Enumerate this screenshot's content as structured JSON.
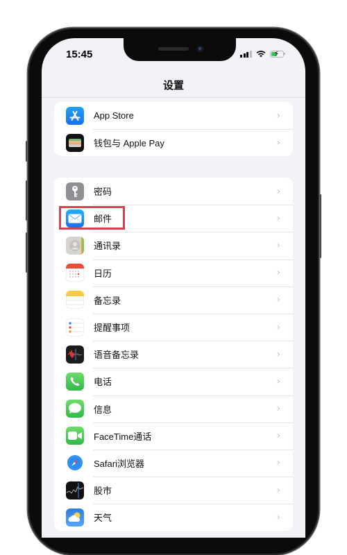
{
  "status_bar": {
    "time": "15:45",
    "battery_state": "charging"
  },
  "nav": {
    "title": "设置"
  },
  "groups": [
    {
      "items": [
        {
          "label": "App Store",
          "icon": "app-store-icon"
        },
        {
          "label": "钱包与 Apple Pay",
          "icon": "wallet-icon"
        }
      ]
    },
    {
      "items": [
        {
          "label": "密码",
          "icon": "key-icon"
        },
        {
          "label": "邮件",
          "icon": "mail-icon",
          "highlighted": true
        },
        {
          "label": "通讯录",
          "icon": "contacts-icon"
        },
        {
          "label": "日历",
          "icon": "calendar-icon"
        },
        {
          "label": "备忘录",
          "icon": "notes-icon"
        },
        {
          "label": "提醒事项",
          "icon": "reminders-icon"
        },
        {
          "label": "语音备忘录",
          "icon": "voice-memos-icon"
        },
        {
          "label": "电话",
          "icon": "phone-icon"
        },
        {
          "label": "信息",
          "icon": "messages-icon"
        },
        {
          "label": "FaceTime通话",
          "icon": "facetime-icon"
        },
        {
          "label": "Safari浏览器",
          "icon": "safari-icon"
        },
        {
          "label": "股市",
          "icon": "stocks-icon"
        },
        {
          "label": "天气",
          "icon": "weather-icon"
        }
      ]
    }
  ],
  "chevron": "›",
  "highlight_color": "#d9404f"
}
